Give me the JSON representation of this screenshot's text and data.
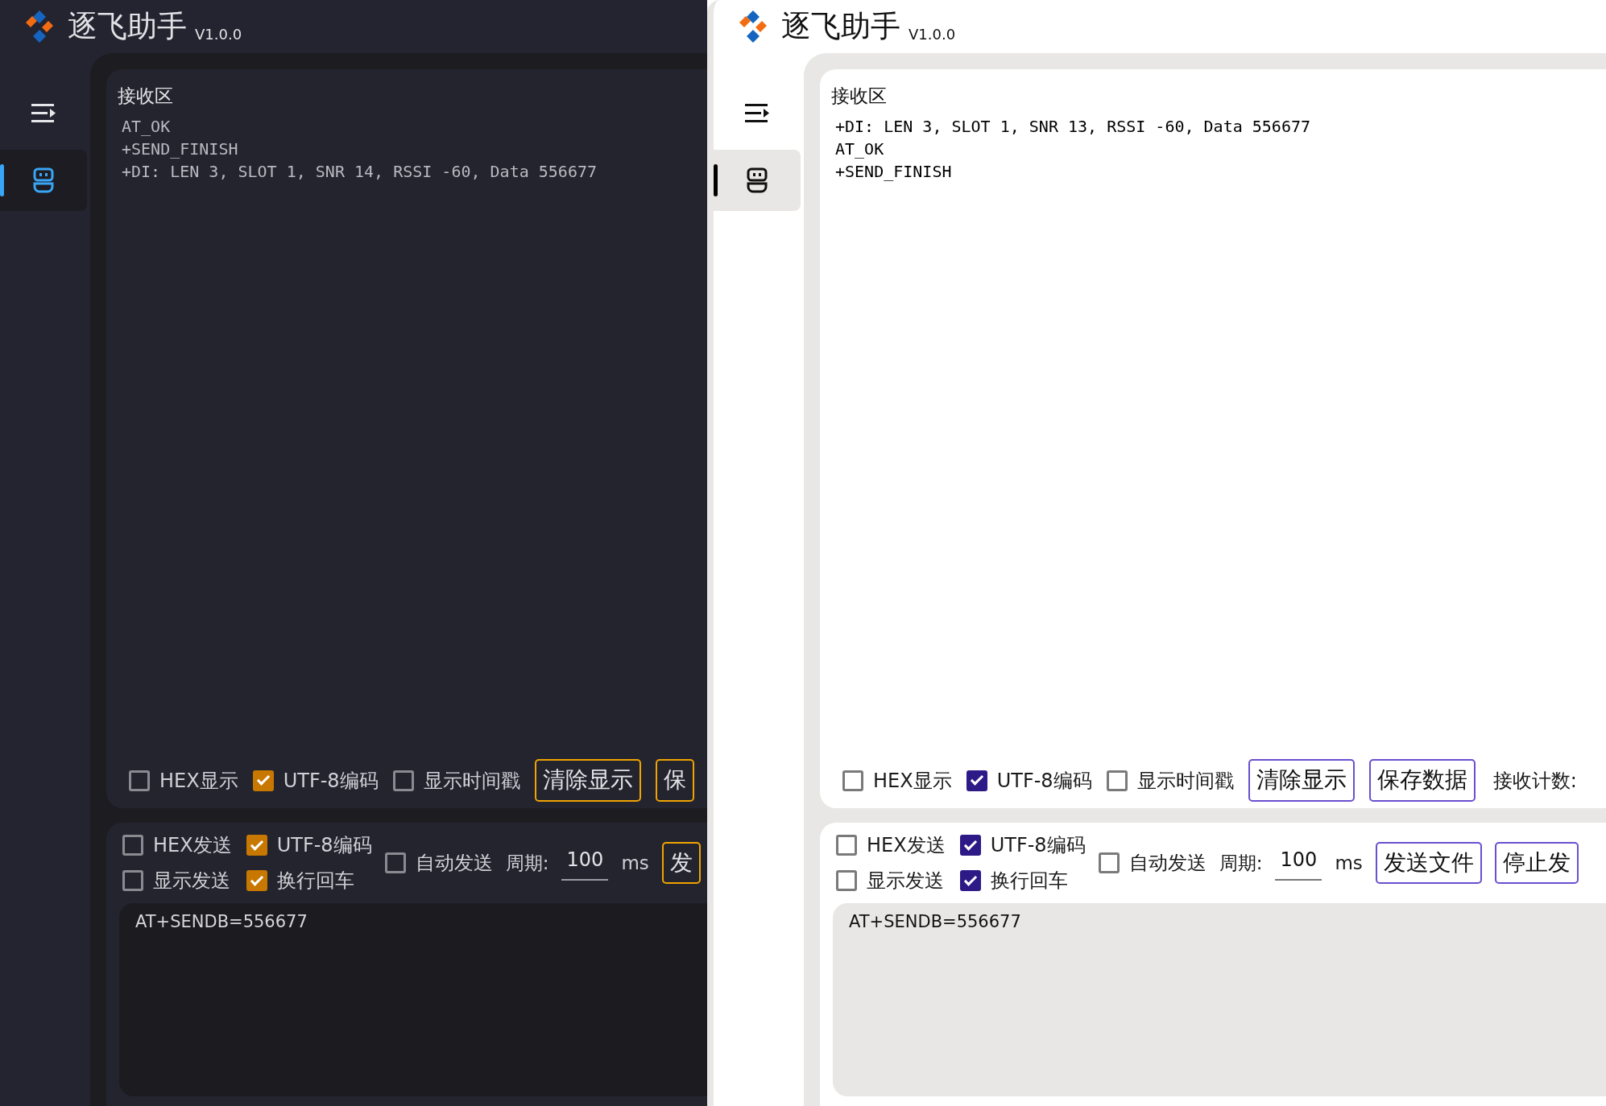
{
  "windows": [
    {
      "kind": "dark",
      "title": "逐飞助手",
      "version": "V1.0.0",
      "sidebar": {
        "items": [
          {
            "kind": "menu",
            "selected": false
          },
          {
            "kind": "robot",
            "selected": true
          }
        ]
      },
      "receive": {
        "title": "接收区",
        "lines": [
          "AT_OK",
          "+SEND_FINISH",
          "+DI: LEN 3, SLOT 1, SNR 14, RSSI -60, Data 556677"
        ],
        "options": [
          {
            "label": "HEX显示",
            "checked": false
          },
          {
            "label": "UTF-8编码",
            "checked": true
          },
          {
            "label": "显示时间戳",
            "checked": false
          }
        ],
        "buttons": [
          "清除显示",
          "保"
        ]
      },
      "send": {
        "options": [
          {
            "label": "HEX发送",
            "checked": false
          },
          {
            "label": "UTF-8编码",
            "checked": true
          },
          {
            "label": "显示发送",
            "checked": false
          },
          {
            "label": "换行回车",
            "checked": true
          }
        ],
        "auto_send": {
          "label": "自动发送",
          "checked": false
        },
        "period_label": "周期:",
        "period_value": "100",
        "unit": "ms",
        "buttons": [
          "发"
        ],
        "input_value": "AT+SENDB=556677"
      }
    },
    {
      "kind": "light",
      "title": "逐飞助手",
      "version": "V1.0.0",
      "sidebar": {
        "items": [
          {
            "kind": "menu",
            "selected": false
          },
          {
            "kind": "robot",
            "selected": true
          }
        ]
      },
      "receive": {
        "title": "接收区",
        "lines": [
          "+DI: LEN 3, SLOT 1, SNR 13, RSSI -60, Data 556677",
          "AT_OK",
          "+SEND_FINISH"
        ],
        "options": [
          {
            "label": "HEX显示",
            "checked": false
          },
          {
            "label": "UTF-8编码",
            "checked": true
          },
          {
            "label": "显示时间戳",
            "checked": false
          }
        ],
        "buttons": [
          "清除显示",
          "保存数据"
        ],
        "count_label": "接收计数:"
      },
      "send": {
        "options": [
          {
            "label": "HEX发送",
            "checked": false
          },
          {
            "label": "UTF-8编码",
            "checked": true
          },
          {
            "label": "显示发送",
            "checked": false
          },
          {
            "label": "换行回车",
            "checked": true
          }
        ],
        "auto_send": {
          "label": "自动发送",
          "checked": false
        },
        "period_label": "周期:",
        "period_value": "100",
        "unit": "ms",
        "buttons": [
          "发送文件",
          "停止发"
        ],
        "input_value": "AT+SENDB=556677"
      }
    }
  ]
}
